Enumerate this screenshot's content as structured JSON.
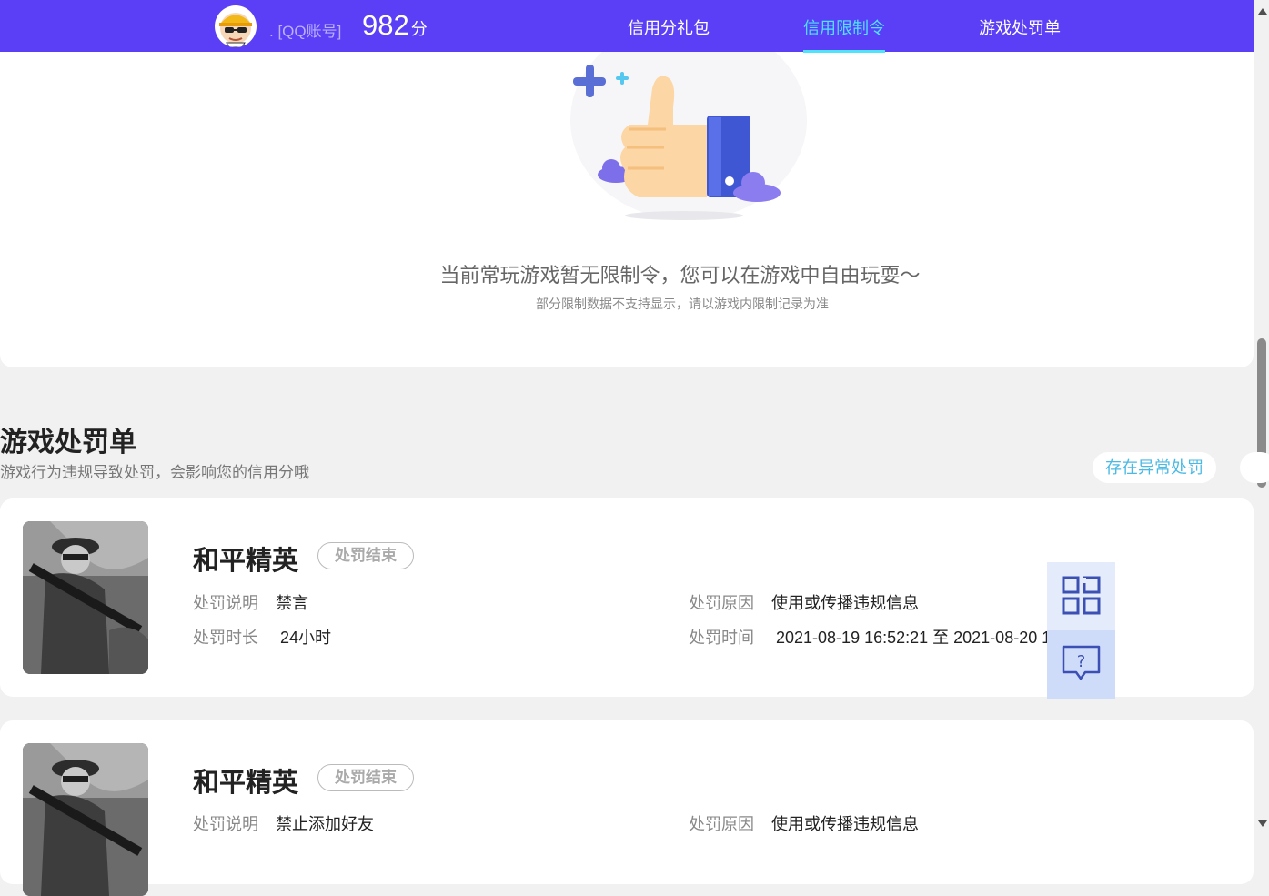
{
  "header": {
    "qq_account": ". [QQ账号]",
    "score_value": "982",
    "score_unit": "分",
    "tabs": [
      {
        "label": "信用分礼包"
      },
      {
        "label": "信用限制令"
      },
      {
        "label": "游戏处罚单"
      }
    ],
    "active_tab": "信用限制令",
    "colors": {
      "header_bg": "#5a3ff6",
      "active_tab": "#4ee3ff"
    }
  },
  "restriction": {
    "empty_message": "当前常玩游戏暂无限制令，您可以在游戏中自由玩耍～",
    "empty_note": "部分限制数据不支持显示，请以游戏内限制记录为准",
    "illustration_icon": "thumbs-up-icon"
  },
  "penalty_section": {
    "title": "游戏处罚单",
    "subtitle": "游戏行为违规导致处罚，会影响您的信用分哦",
    "abnormal_button": "存在异常处罚",
    "records": [
      {
        "game": "和平精英",
        "status": "处罚结束",
        "desc_label": "处罚说明",
        "desc_value": "禁言",
        "reason_label": "处罚原因",
        "reason_value": "使用或传播违规信息",
        "duration_label": "处罚时长",
        "duration_value": "24小时",
        "time_label": "处罚时间",
        "time_value": "2021-08-19 16:52:21 至 2021-08-20 1"
      },
      {
        "game": "和平精英",
        "status": "处罚结束",
        "desc_label": "处罚说明",
        "desc_value": "禁止添加好友",
        "reason_label": "处罚原因",
        "reason_value": "使用或传播违规信息"
      }
    ]
  },
  "float_tools": [
    {
      "icon": "qr-code-icon"
    },
    {
      "icon": "help-chat-icon"
    }
  ]
}
